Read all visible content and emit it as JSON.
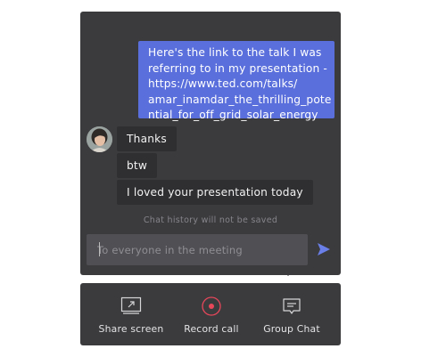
{
  "chat": {
    "outgoing_message_lines": [
      "Here's the link to the talk I was",
      "referring to in my presentation -",
      "https://www.ted.com/talks/",
      "amar_inamdar_the_thrilling_pote",
      "ntial_for_off_grid_solar_energy"
    ],
    "incoming_messages": [
      "Thanks",
      "btw",
      "I loved your presentation today"
    ],
    "history_notice": "Chat history will not be saved",
    "input_placeholder": "To everyone in the meeting",
    "input_value": ""
  },
  "toolbar": {
    "share_label": "Share screen",
    "record_label": "Record call",
    "chat_label": "Group Chat"
  },
  "colors": {
    "panel": "#3b3b3e",
    "outgoing_bubble": "#5a6fdb",
    "incoming_bubble": "#2f2f32",
    "send_accent": "#6a7fe8",
    "record_accent": "#e8475a"
  },
  "icons": {
    "send": "send-icon",
    "share": "share-screen-icon",
    "record": "record-icon",
    "chat": "chat-bubble-icon"
  }
}
